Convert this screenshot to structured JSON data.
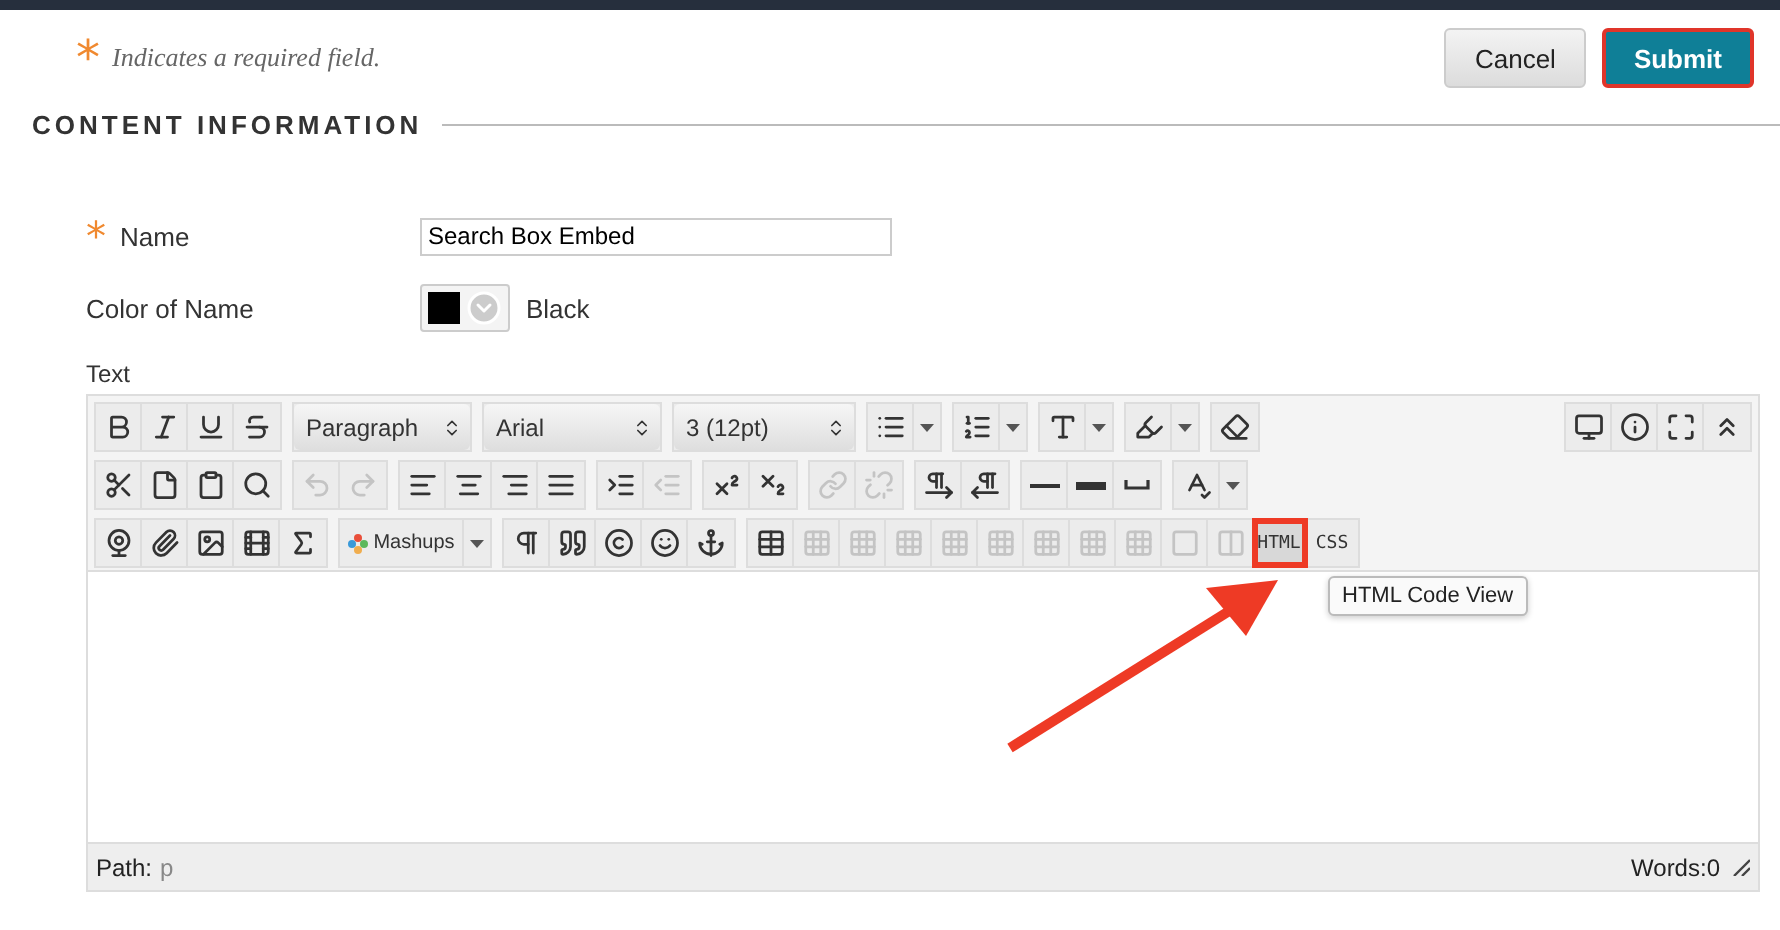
{
  "required_note": {
    "mark": "*",
    "text": "Indicates a required field."
  },
  "actions": [
    {
      "label": "Cancel",
      "primary": false
    },
    {
      "label": "Submit",
      "primary": true
    }
  ],
  "section_title": "CONTENT INFORMATION",
  "name_field": {
    "required_mark": "*",
    "label": "Name",
    "value": "Search Box Embed"
  },
  "color_field": {
    "label": "Color of Name",
    "color": "#000000",
    "value": "Black"
  },
  "text_label": "Text",
  "toolbar": {
    "rows": [
      {
        "groups": [
          [
            {
              "kind": "icon",
              "disabled": false
            },
            {
              "kind": "icon",
              "disabled": false
            },
            {
              "kind": "icon",
              "disabled": false
            },
            {
              "kind": "icon",
              "disabled": false
            }
          ],
          [
            {
              "kind": "select",
              "label": "Paragraph"
            }
          ],
          [
            {
              "kind": "select",
              "label": "Arial"
            }
          ],
          [
            {
              "kind": "select",
              "label": "3 (12pt)"
            }
          ],
          [
            {
              "kind": "split",
              "disabled": false
            }
          ],
          [
            {
              "kind": "split",
              "disabled": false
            }
          ],
          [
            {
              "kind": "split",
              "disabled": false
            }
          ],
          [
            {
              "kind": "split",
              "disabled": false
            }
          ],
          [
            {
              "kind": "icon",
              "disabled": false
            }
          ]
        ],
        "right_groups": [
          [
            {
              "kind": "icon",
              "disabled": false
            },
            {
              "kind": "icon",
              "disabled": false
            },
            {
              "kind": "icon",
              "disabled": false
            },
            {
              "kind": "icon",
              "disabled": false
            }
          ]
        ]
      },
      {
        "groups": [
          [
            {
              "kind": "icon",
              "disabled": false
            },
            {
              "kind": "icon",
              "disabled": false
            },
            {
              "kind": "icon",
              "disabled": false
            },
            {
              "kind": "icon",
              "disabled": false
            }
          ],
          [
            {
              "kind": "icon",
              "disabled": true
            },
            {
              "kind": "icon",
              "disabled": true
            }
          ],
          [
            {
              "kind": "icon",
              "disabled": false
            },
            {
              "kind": "icon",
              "disabled": false
            },
            {
              "kind": "icon",
              "disabled": false
            },
            {
              "kind": "icon",
              "disabled": false
            }
          ],
          [
            {
              "kind": "icon",
              "disabled": false
            },
            {
              "kind": "icon",
              "disabled": true
            }
          ],
          [
            {
              "kind": "icon",
              "disabled": false
            },
            {
              "kind": "icon",
              "disabled": false
            }
          ],
          [
            {
              "kind": "icon",
              "disabled": true
            },
            {
              "kind": "icon",
              "disabled": true
            }
          ],
          [
            {
              "kind": "icon",
              "disabled": false
            },
            {
              "kind": "icon",
              "disabled": false
            }
          ],
          [
            {
              "kind": "icon",
              "disabled": false
            },
            {
              "kind": "icon",
              "disabled": false
            },
            {
              "kind": "icon",
              "disabled": false
            }
          ],
          [
            {
              "kind": "split",
              "disabled": false
            }
          ]
        ],
        "right_groups": []
      },
      {
        "groups": [
          [
            {
              "kind": "icon",
              "disabled": false
            },
            {
              "kind": "icon",
              "disabled": false
            },
            {
              "kind": "icon",
              "disabled": false
            },
            {
              "kind": "icon",
              "disabled": false
            },
            {
              "kind": "icon",
              "disabled": false
            }
          ],
          [
            {
              "kind": "menu",
              "label": "Mashups"
            }
          ],
          [
            {
              "kind": "icon",
              "disabled": false
            },
            {
              "kind": "icon",
              "disabled": false
            },
            {
              "kind": "icon",
              "disabled": false
            },
            {
              "kind": "icon",
              "disabled": false
            },
            {
              "kind": "icon",
              "disabled": false
            }
          ],
          [
            {
              "kind": "icon",
              "disabled": false
            },
            {
              "kind": "icon",
              "disabled": true
            },
            {
              "kind": "icon",
              "disabled": true
            },
            {
              "kind": "icon",
              "disabled": true
            },
            {
              "kind": "icon",
              "disabled": true
            },
            {
              "kind": "icon",
              "disabled": true
            },
            {
              "kind": "icon",
              "disabled": true
            },
            {
              "kind": "icon",
              "disabled": true
            },
            {
              "kind": "icon",
              "disabled": true
            },
            {
              "kind": "icon",
              "disabled": true
            },
            {
              "kind": "icon",
              "disabled": true
            },
            {
              "kind": "text",
              "label": "HTML",
              "annotated": true,
              "disabled": false
            },
            {
              "kind": "text",
              "label": "CSS",
              "annotated": false,
              "disabled": false
            }
          ]
        ],
        "right_groups": []
      }
    ]
  },
  "tooltip": "HTML Code View",
  "status_bar": {
    "path_label": "Path:",
    "path_value": "p",
    "words": "Words:0"
  }
}
